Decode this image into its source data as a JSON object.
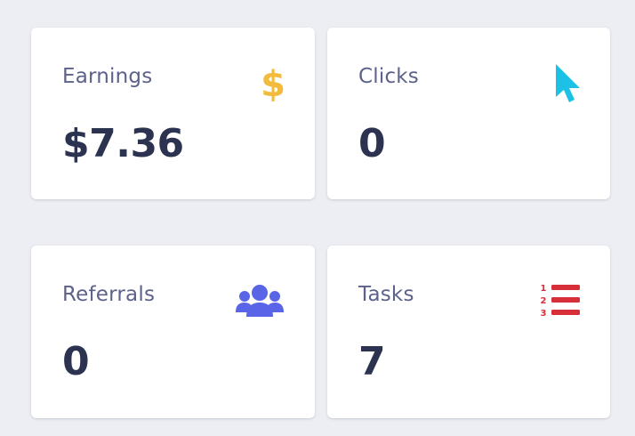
{
  "cards": [
    {
      "label": "Earnings",
      "value": "$7.36",
      "icon": "dollar-sign-icon",
      "icon_color": "#f2bb3b"
    },
    {
      "label": "Clicks",
      "value": "0",
      "icon": "mouse-pointer-icon",
      "icon_color": "#1ec1e6"
    },
    {
      "label": "Referrals",
      "value": "0",
      "icon": "users-icon",
      "icon_color": "#5a64e6"
    },
    {
      "label": "Tasks",
      "value": "7",
      "icon": "numbered-list-icon",
      "icon_color": "#d62f3a"
    }
  ]
}
